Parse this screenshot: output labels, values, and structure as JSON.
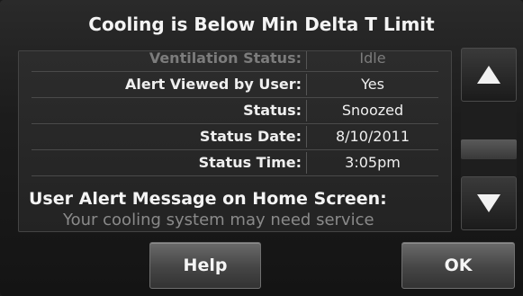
{
  "title": "Cooling is Below Min Delta T Limit",
  "details": [
    {
      "label": "Ventilation Status:",
      "value": "Idle"
    },
    {
      "label": "Alert Viewed by User:",
      "value": "Yes"
    },
    {
      "label": "Status:",
      "value": "Snoozed"
    },
    {
      "label": "Status Date:",
      "value": "8/10/2011"
    },
    {
      "label": "Status Time:",
      "value": "3:05pm"
    }
  ],
  "message": {
    "heading": "User Alert Message on Home Screen:",
    "body": "Your cooling system may need service"
  },
  "buttons": {
    "help": "Help",
    "ok": "OK"
  },
  "icons": {
    "scroll_up": "up-arrow-icon",
    "scroll_down": "down-arrow-icon"
  }
}
